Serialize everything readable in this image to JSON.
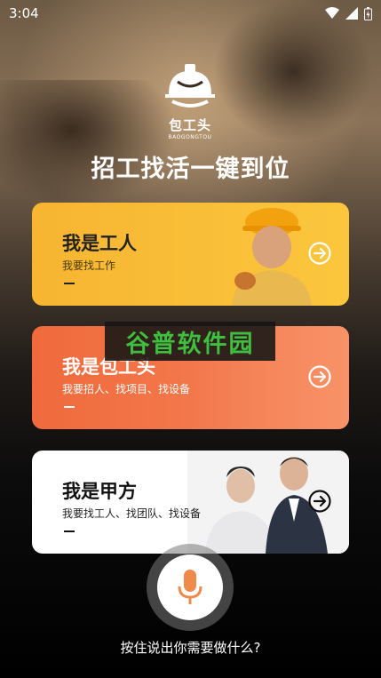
{
  "status_bar": {
    "time": "3:04"
  },
  "logo": {
    "name": "包工头",
    "pinyin": "BAOGONGTOU"
  },
  "slogan": "招工找活一键到位",
  "cards": [
    {
      "title": "我是工人",
      "subtitle": "我要找工作",
      "dash": "—"
    },
    {
      "title": "我是包工头",
      "subtitle": "我要招人、找项目、找设备",
      "dash": "—"
    },
    {
      "title": "我是甲方",
      "subtitle": "我要找工人、找团队、找设备",
      "dash": "—"
    }
  ],
  "watermark": "谷普软件园",
  "voice_hint": "按住说出你需要做什么?",
  "colors": {
    "worker_card": "#fbc63d",
    "contractor_card": "#f5855a",
    "client_card": "#ffffff",
    "mic_icon": "#f08a4b"
  }
}
